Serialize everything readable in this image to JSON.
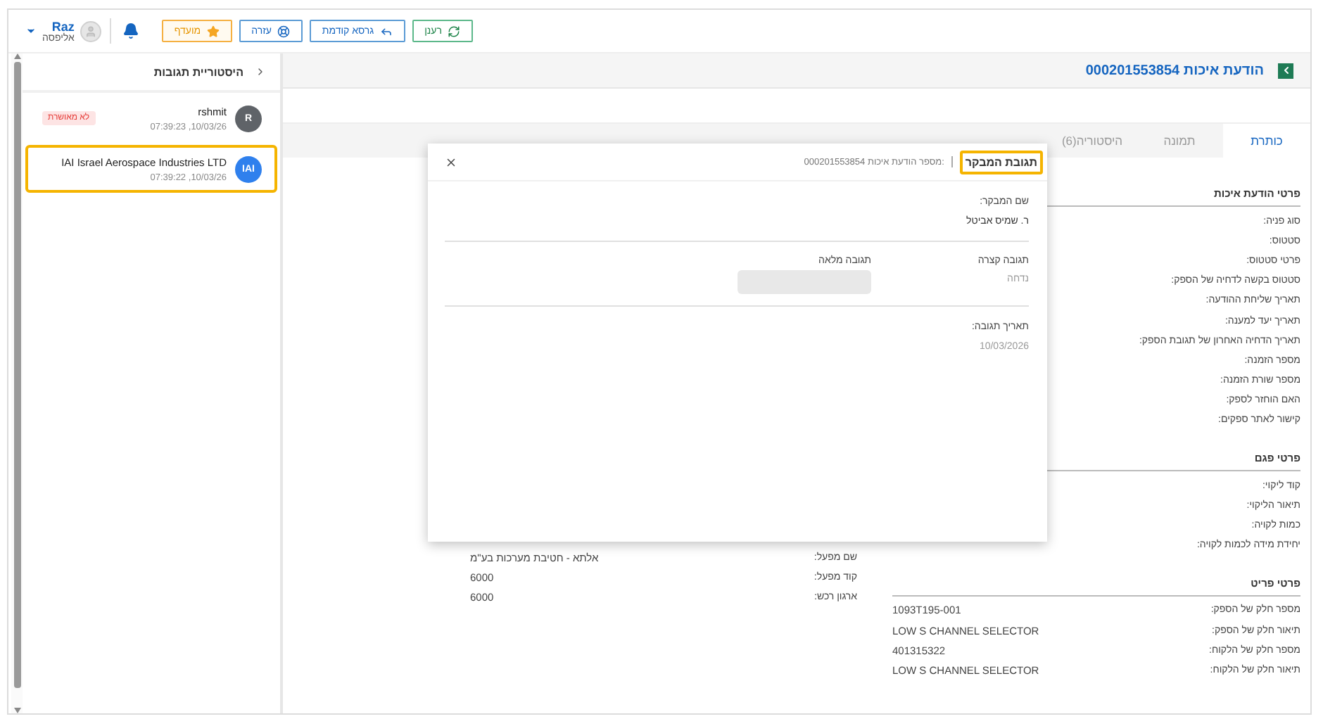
{
  "topbar": {
    "user": {
      "name": "Raz",
      "org": "אליפסה"
    },
    "buttons": [
      {
        "label": "רענן",
        "kind": "refresh"
      },
      {
        "label": "גרסא קודמת",
        "kind": "back"
      },
      {
        "label": "עזרה",
        "kind": "help"
      },
      {
        "label": "מועדף",
        "kind": "favorite"
      }
    ]
  },
  "history": {
    "title": "היסטוריית תגובות",
    "items": [
      {
        "avatar": "R",
        "name": "rshmit",
        "time": "10/03/26, 07:39:23",
        "badge": "לא מאושרת",
        "selected": false,
        "color": "#5f6368"
      },
      {
        "avatar": "IAI",
        "name": "IAI Israel Aerospace Industries LTD",
        "time": "10/03/26, 07:39:22",
        "selected": true,
        "color": "#2f80ed"
      }
    ]
  },
  "notice": {
    "title": "הודעת איכות 000201553854",
    "tabs": [
      {
        "label": "כותרת",
        "selected": true
      },
      {
        "label": "תמונה",
        "selected": false
      },
      {
        "label": "היסטוריה(6)",
        "selected": false
      }
    ],
    "sections": [
      {
        "title": "פרטי הודעת איכות",
        "rows": [
          {
            "label": "סוג פניה:"
          },
          {
            "label": "סטטוס:"
          },
          {
            "label": "פרטי סטטוס:"
          },
          {
            "label": "סטטוס בקשה לדחיה של הספק:"
          },
          {
            "label": "תאריך שליחת ההודעה:"
          },
          {
            "label": "תאריך יעד למענה:"
          },
          {
            "label": "תאריך הדחיה האחרון של תגובת הספק:"
          },
          {
            "label": "מספר הזמנה:"
          },
          {
            "label": "מספר שורת הזמנה:"
          },
          {
            "label": "האם הוחזר לספק:"
          },
          {
            "label": "קישור לאתר ספקים:"
          }
        ]
      },
      {
        "title": "פרטי פגם",
        "rows": [
          {
            "label": "קוד ליקוי:"
          },
          {
            "label": "תיאור הליקוי:"
          },
          {
            "label": "כמות לקויה:"
          },
          {
            "label": "יחידת מידה לכמות לקויה:"
          }
        ]
      },
      {
        "title": "פרטי פריט",
        "rows": [
          {
            "label": "מספר חלק של הספק:",
            "value": "1093T195-001"
          },
          {
            "label": "תיאור חלק של הספק:",
            "value": "LOW S CHANNEL SELECTOR"
          },
          {
            "label": "מספר חלק של הלקוח:",
            "value": "401315322"
          },
          {
            "label": "תיאור חלק של הלקוח:",
            "value": "LOW S CHANNEL SELECTOR"
          }
        ]
      }
    ],
    "side_rows": [
      {
        "label": "שם מפעל:",
        "value": "אלתא - חטיבת מערכות בע\"מ"
      },
      {
        "label": "קוד מפעל:",
        "value": "6000"
      },
      {
        "label": "ארגון רכש:",
        "value": "6000"
      }
    ]
  },
  "dialog": {
    "title": "תגובת המבקר",
    "subtitle": ":מספר הודעת איכות 000201553854",
    "reviewer_label": "שם המבקר:",
    "reviewer": "ר. שמיס אביטל",
    "short_label": "תגובה קצרה",
    "short_value": "נדחה",
    "full_label": "תגובה מלאה",
    "date_label": "תאריך תגובה:",
    "date": "10/03/2026"
  }
}
